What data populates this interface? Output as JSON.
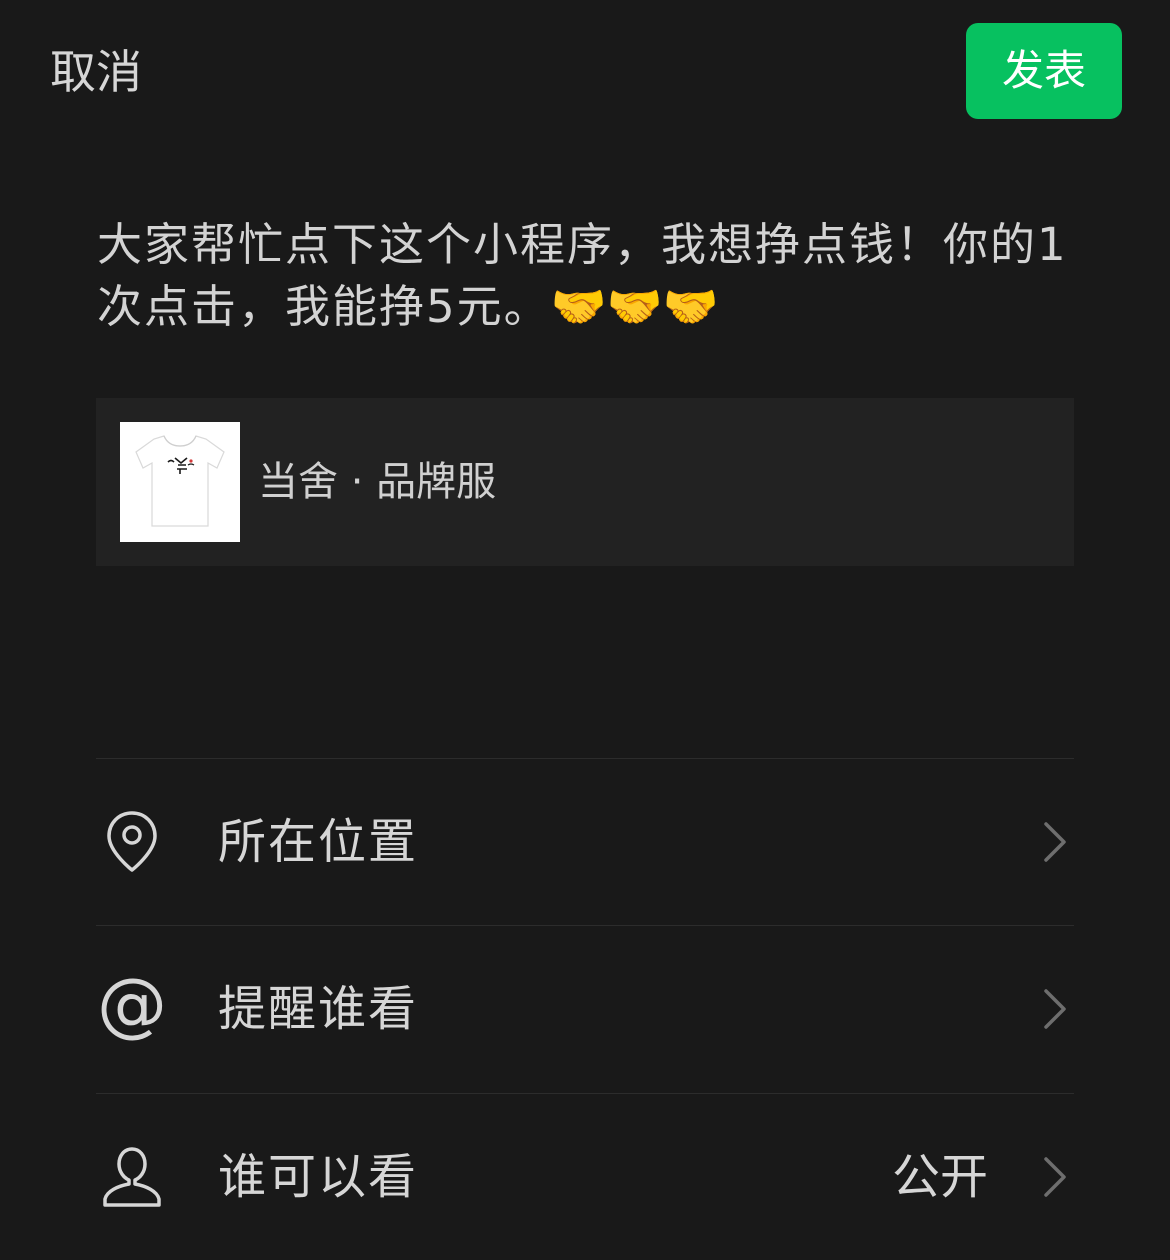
{
  "header": {
    "cancel_label": "取消",
    "publish_label": "发表",
    "publish_color": "#07c160"
  },
  "post": {
    "text": "大家帮忙点下这个小程序，我想挣点钱！你的1次点击，我能挣5元。",
    "emojis": [
      "🤝",
      "🤝",
      "🤝"
    ]
  },
  "link_card": {
    "thumbnail": "white-tshirt-image",
    "title": "当舍 · 品牌服"
  },
  "options": [
    {
      "icon": "location-pin-icon",
      "label": "所在位置",
      "value": ""
    },
    {
      "icon": "at-sign-icon",
      "label": "提醒谁看",
      "value": ""
    },
    {
      "icon": "person-icon",
      "label": "谁可以看",
      "value": "公开"
    }
  ]
}
